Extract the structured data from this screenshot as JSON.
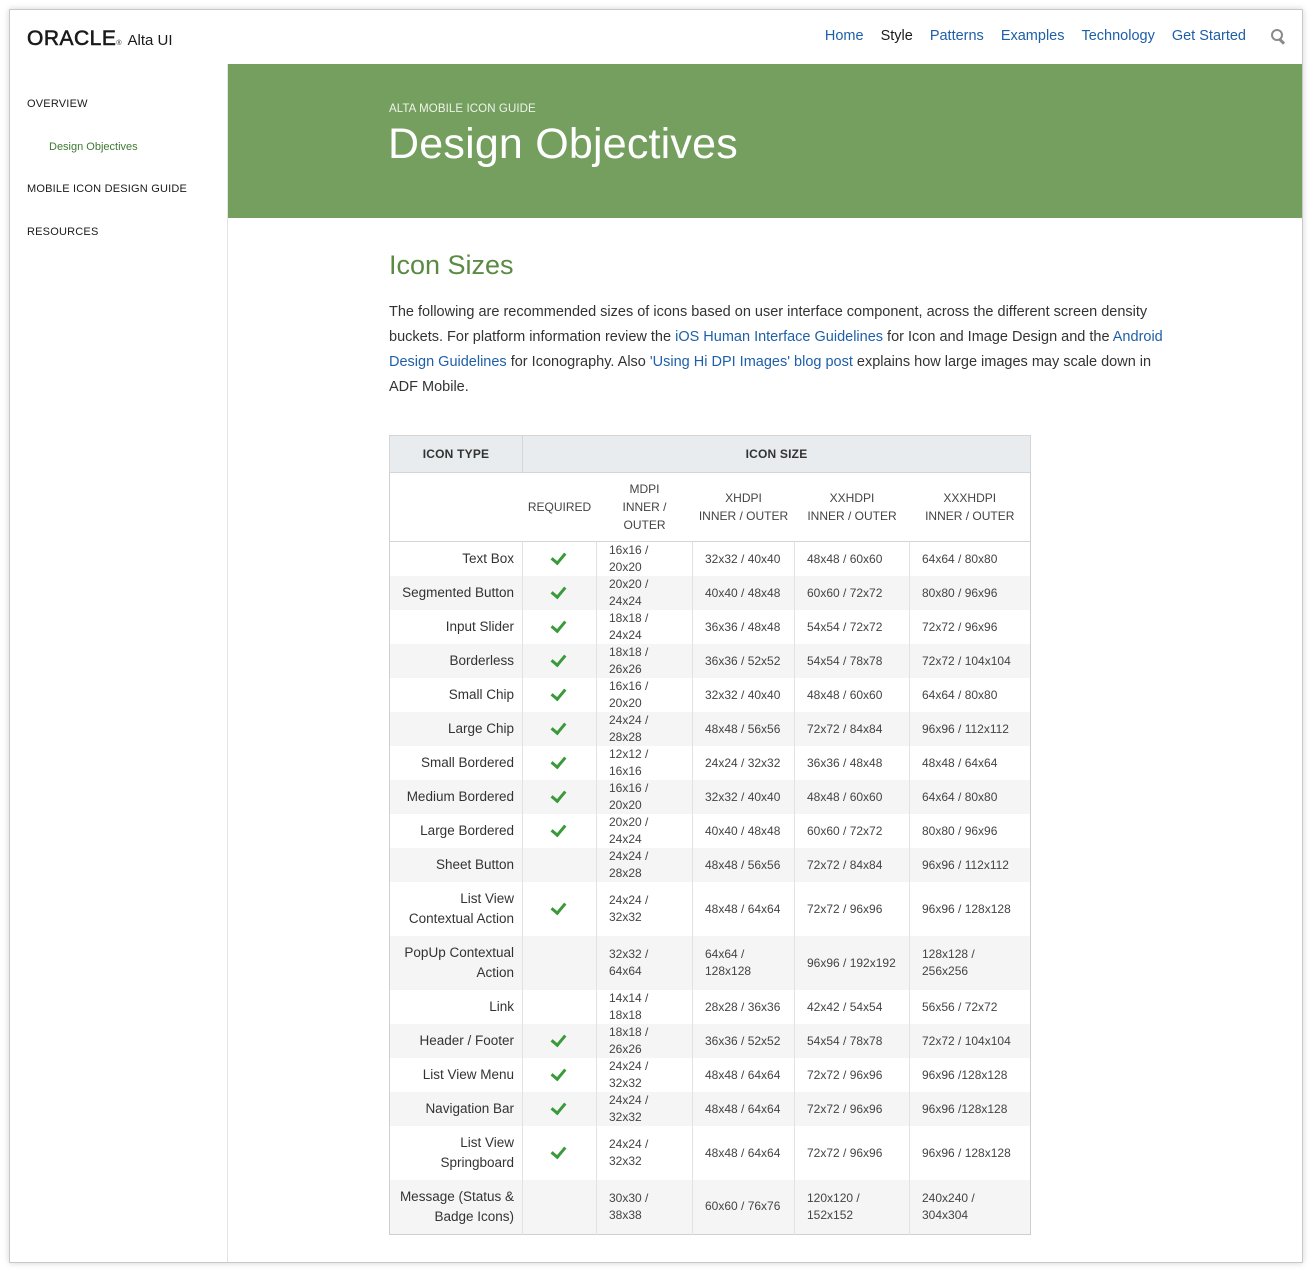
{
  "header": {
    "logo_mark": "ORACLE",
    "logo_tm": "®",
    "product": "Alta UI",
    "nav": [
      {
        "label": "Home",
        "active": false
      },
      {
        "label": "Style",
        "active": true
      },
      {
        "label": "Patterns",
        "active": false
      },
      {
        "label": "Examples",
        "active": false
      },
      {
        "label": "Technology",
        "active": false
      },
      {
        "label": "Get Started",
        "active": false
      }
    ],
    "search_icon": "search-icon"
  },
  "sidebar": {
    "overview": "OVERVIEW",
    "design_objectives": "Design Objectives",
    "mobile_guide": "MOBILE ICON DESIGN GUIDE",
    "resources": "RESOURCES"
  },
  "hero": {
    "eyebrow": "ALTA MOBILE ICON GUIDE",
    "title": "Design Objectives",
    "color": "#759f5e"
  },
  "content": {
    "section_title": "Icon Sizes",
    "intro": {
      "t1": "The following are recommended sizes of icons based on user interface component, across the different screen density buckets. For platform information review the ",
      "link1": "iOS Human Interface Guidelines",
      "t2": " for Icon and Image Design and the ",
      "link2": "Android Design Guidelines",
      "t3": " for Iconography. Also ",
      "link3": "'Using Hi DPI Images' blog post",
      "t4": " explains how large images may scale down in ADF Mobile."
    }
  },
  "table": {
    "group_headers": {
      "icon_type": "ICON TYPE",
      "icon_size": "ICON SIZE"
    },
    "sub_headers": {
      "required": "REQUIRED",
      "mdpi": [
        "MDPI",
        "INNER /",
        "OUTER"
      ],
      "xhdpi": [
        "XHDPI",
        "INNER / OUTER"
      ],
      "xxhdpi": [
        "XXHDPI",
        "INNER / OUTER"
      ],
      "xxxhdpi": [
        "XXXHDPI",
        "INNER / OUTER"
      ]
    },
    "check_icon": "check-icon",
    "rows": [
      {
        "type": [
          "Text Box"
        ],
        "required": true,
        "mdpi": [
          "16x16 / 20x20"
        ],
        "xhdpi": [
          "32x32 / 40x40"
        ],
        "xxhdpi": [
          "48x48 / 60x60"
        ],
        "xxxhdpi": [
          "64x64 / 80x80"
        ]
      },
      {
        "type": [
          "Segmented Button"
        ],
        "required": true,
        "mdpi": [
          "20x20 / 24x24"
        ],
        "xhdpi": [
          "40x40 / 48x48"
        ],
        "xxhdpi": [
          "60x60 / 72x72"
        ],
        "xxxhdpi": [
          "80x80 / 96x96"
        ]
      },
      {
        "type": [
          "Input Slider"
        ],
        "required": true,
        "mdpi": [
          "18x18 / 24x24"
        ],
        "xhdpi": [
          "36x36 / 48x48"
        ],
        "xxhdpi": [
          "54x54 / 72x72"
        ],
        "xxxhdpi": [
          "72x72 / 96x96"
        ]
      },
      {
        "type": [
          "Borderless"
        ],
        "required": true,
        "mdpi": [
          "18x18 / 26x26"
        ],
        "xhdpi": [
          "36x36 / 52x52"
        ],
        "xxhdpi": [
          "54x54 / 78x78"
        ],
        "xxxhdpi": [
          "72x72 / 104x104"
        ]
      },
      {
        "type": [
          "Small Chip"
        ],
        "required": true,
        "mdpi": [
          "16x16 / 20x20"
        ],
        "xhdpi": [
          "32x32 / 40x40"
        ],
        "xxhdpi": [
          "48x48 / 60x60"
        ],
        "xxxhdpi": [
          "64x64 / 80x80"
        ]
      },
      {
        "type": [
          "Large Chip"
        ],
        "required": true,
        "mdpi": [
          "24x24 / 28x28"
        ],
        "xhdpi": [
          "48x48 / 56x56"
        ],
        "xxhdpi": [
          "72x72 / 84x84"
        ],
        "xxxhdpi": [
          "96x96 / 112x112"
        ]
      },
      {
        "type": [
          "Small Bordered"
        ],
        "required": true,
        "mdpi": [
          "12x12 / 16x16"
        ],
        "xhdpi": [
          "24x24 / 32x32"
        ],
        "xxhdpi": [
          "36x36 / 48x48"
        ],
        "xxxhdpi": [
          "48x48 / 64x64"
        ]
      },
      {
        "type": [
          "Medium Bordered"
        ],
        "required": true,
        "mdpi": [
          "16x16 / 20x20"
        ],
        "xhdpi": [
          "32x32 / 40x40"
        ],
        "xxhdpi": [
          "48x48 / 60x60"
        ],
        "xxxhdpi": [
          "64x64 / 80x80"
        ]
      },
      {
        "type": [
          "Large Bordered"
        ],
        "required": true,
        "mdpi": [
          "20x20 / 24x24"
        ],
        "xhdpi": [
          "40x40 / 48x48"
        ],
        "xxhdpi": [
          "60x60 / 72x72"
        ],
        "xxxhdpi": [
          "80x80 / 96x96"
        ]
      },
      {
        "type": [
          "Sheet Button"
        ],
        "required": false,
        "mdpi": [
          "24x24 / 28x28"
        ],
        "xhdpi": [
          "48x48 / 56x56"
        ],
        "xxhdpi": [
          "72x72 / 84x84"
        ],
        "xxxhdpi": [
          "96x96 / 112x112"
        ]
      },
      {
        "type": [
          "List View",
          "Contextual Action"
        ],
        "required": true,
        "mdpi": [
          "24x24 / 32x32"
        ],
        "xhdpi": [
          "48x48 / 64x64"
        ],
        "xxhdpi": [
          "72x72 / 96x96"
        ],
        "xxxhdpi": [
          "96x96 / 128x128"
        ]
      },
      {
        "type": [
          "PopUp Contextual",
          "Action"
        ],
        "required": false,
        "mdpi": [
          "32x32 / 64x64"
        ],
        "xhdpi": [
          "64x64 /",
          "128x128"
        ],
        "xxhdpi": [
          "96x96 / 192x192"
        ],
        "xxxhdpi": [
          "128x128 / 256x256"
        ]
      },
      {
        "type": [
          "Link"
        ],
        "required": false,
        "mdpi": [
          "14x14 / 18x18"
        ],
        "xhdpi": [
          "28x28 / 36x36"
        ],
        "xxhdpi": [
          "42x42 / 54x54"
        ],
        "xxxhdpi": [
          "56x56 / 72x72"
        ]
      },
      {
        "type": [
          "Header / Footer"
        ],
        "required": true,
        "mdpi": [
          "18x18 / 26x26"
        ],
        "xhdpi": [
          "36x36 / 52x52"
        ],
        "xxhdpi": [
          "54x54 / 78x78"
        ],
        "xxxhdpi": [
          "72x72 / 104x104"
        ]
      },
      {
        "type": [
          "List View Menu"
        ],
        "required": true,
        "mdpi": [
          "24x24 / 32x32"
        ],
        "xhdpi": [
          "48x48 / 64x64"
        ],
        "xxhdpi": [
          "72x72 / 96x96"
        ],
        "xxxhdpi": [
          "96x96 /128x128"
        ]
      },
      {
        "type": [
          "Navigation Bar"
        ],
        "required": true,
        "mdpi": [
          "24x24 / 32x32"
        ],
        "xhdpi": [
          "48x48 / 64x64"
        ],
        "xxhdpi": [
          "72x72 / 96x96"
        ],
        "xxxhdpi": [
          "96x96 /128x128"
        ]
      },
      {
        "type": [
          "List View",
          "Springboard"
        ],
        "required": true,
        "mdpi": [
          "24x24 / 32x32"
        ],
        "xhdpi": [
          "48x48 / 64x64"
        ],
        "xxhdpi": [
          "72x72 / 96x96"
        ],
        "xxxhdpi": [
          "96x96 / 128x128"
        ]
      },
      {
        "type": [
          "Message (Status &",
          "Badge Icons)"
        ],
        "required": false,
        "mdpi": [
          "30x30 / 38x38"
        ],
        "xhdpi": [
          "60x60 / 76x76"
        ],
        "xxhdpi": [
          "120x120 /",
          "152x152"
        ],
        "xxxhdpi": [
          "240x240 / 304x304"
        ]
      }
    ]
  }
}
